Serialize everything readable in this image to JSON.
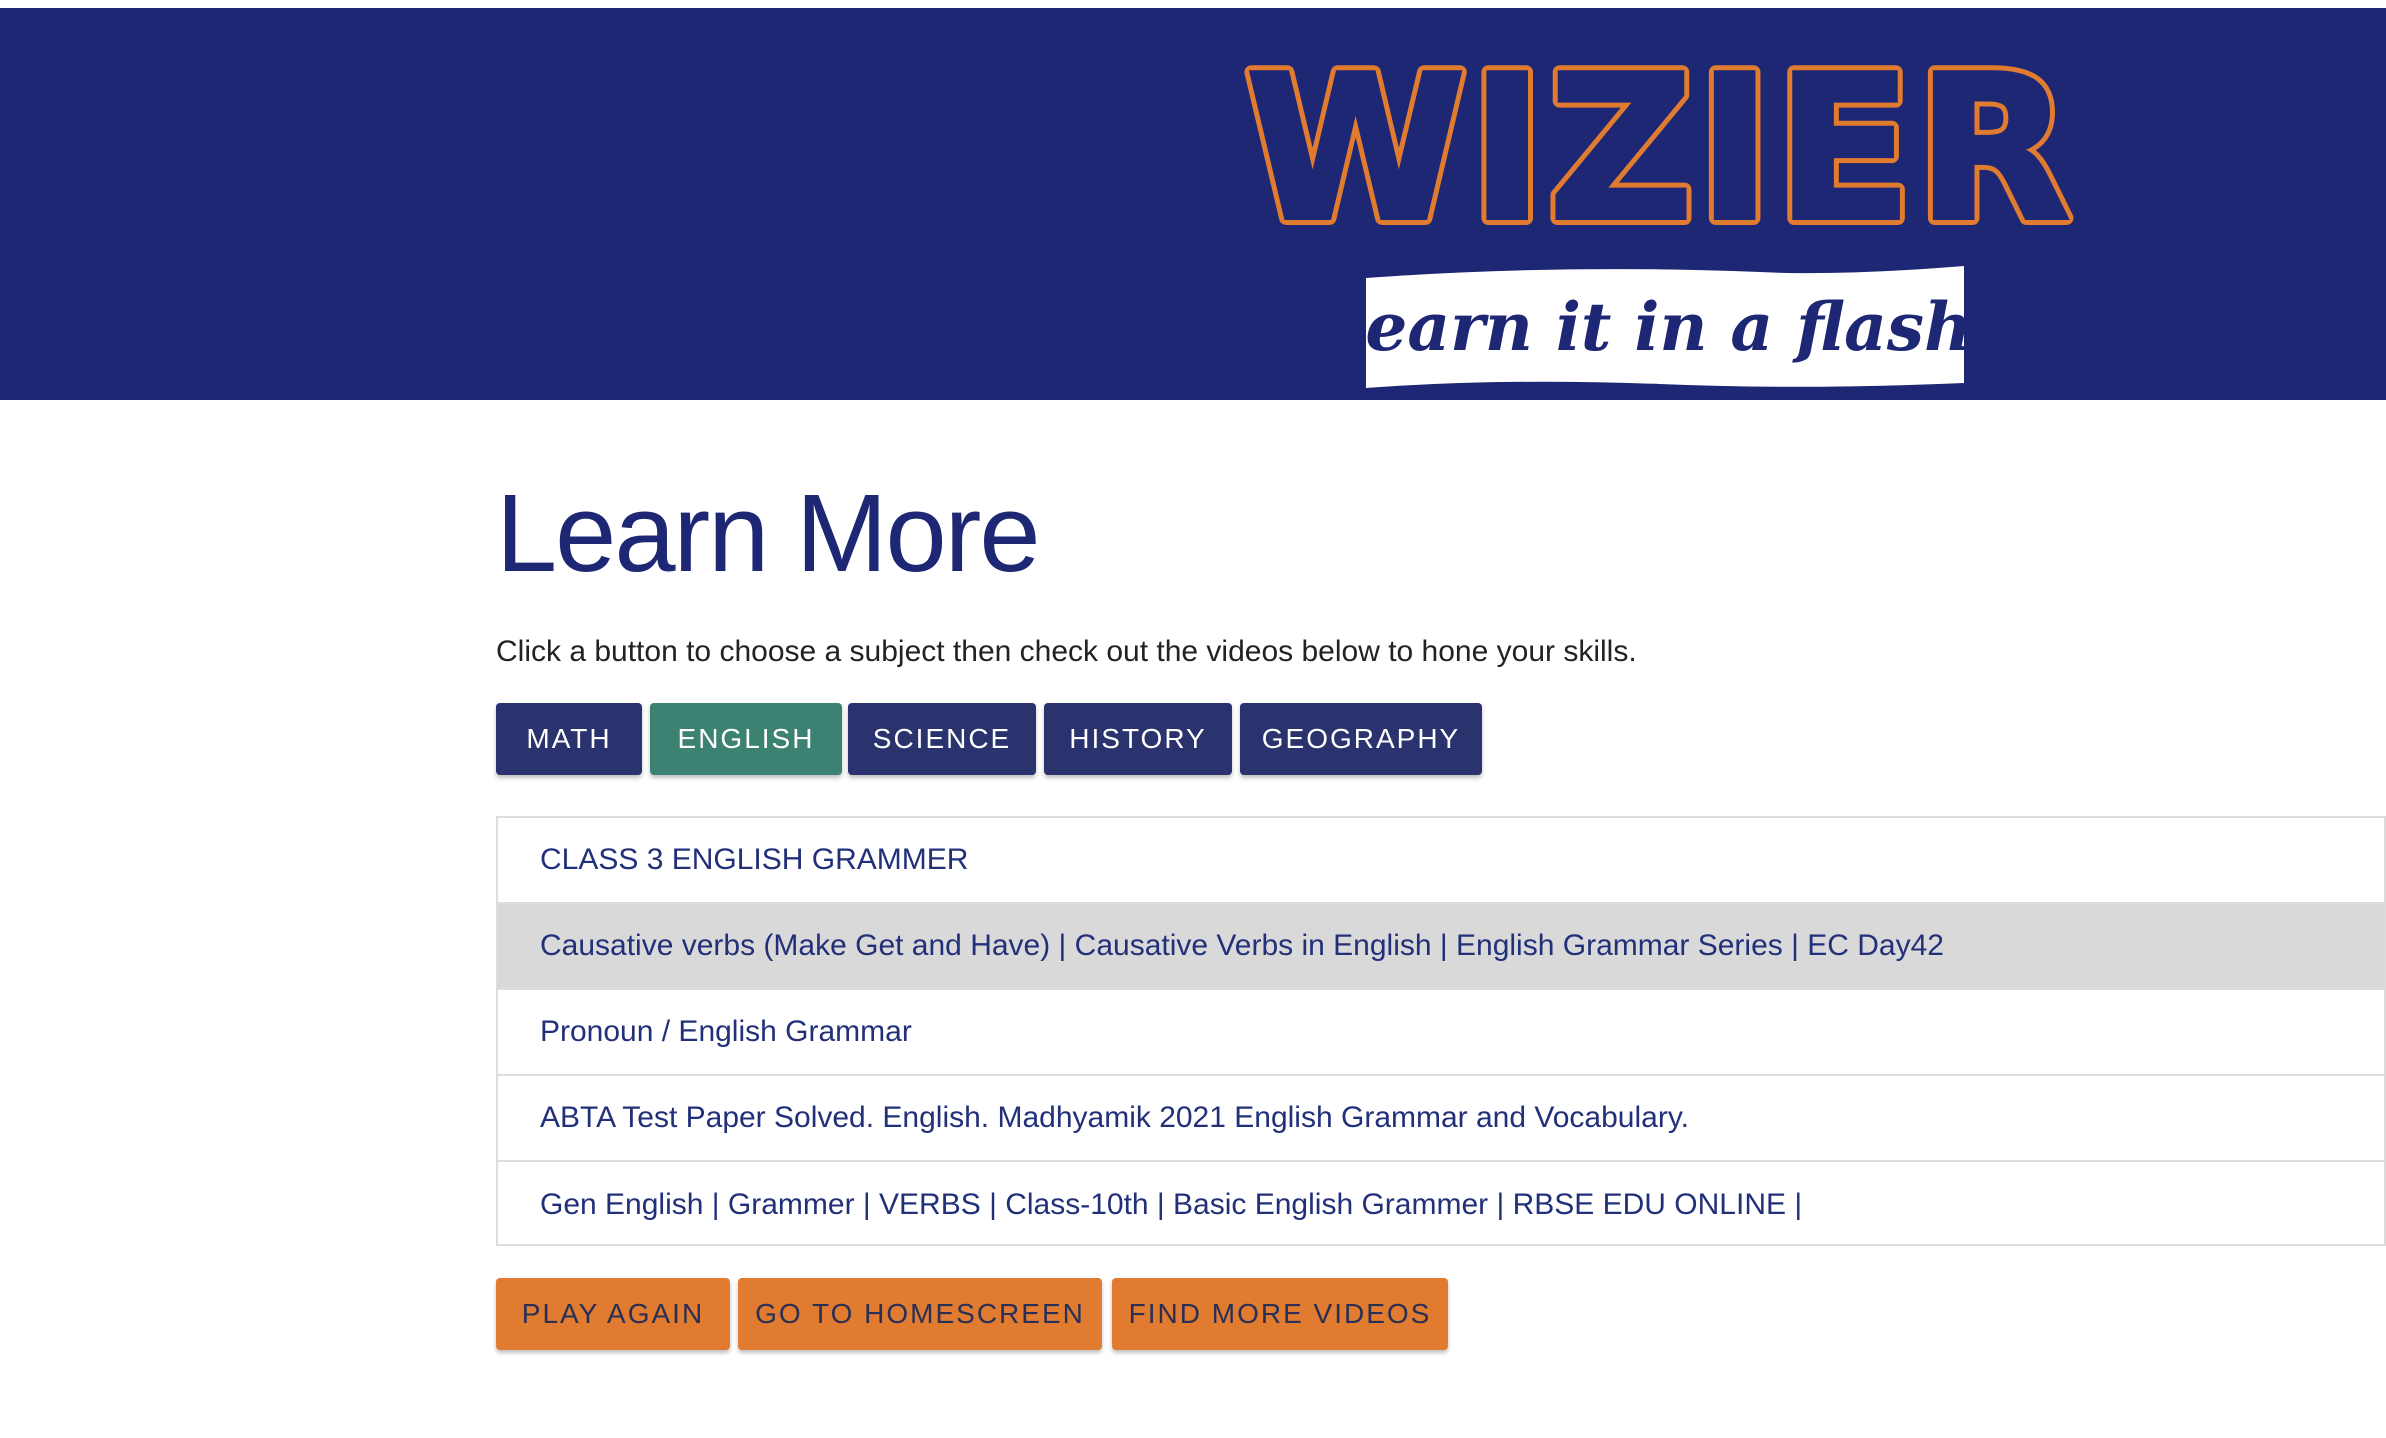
{
  "header": {
    "logo_text": "WIZIER",
    "tagline": "Learn it in a flash!",
    "background_color": "#1d2774",
    "brand_color": "#e07b30"
  },
  "main": {
    "title": "Learn More",
    "instructions": "Click a button to choose a subject then check out the videos below to hone your skills.",
    "subjects": [
      {
        "label": "MATH",
        "selected": false
      },
      {
        "label": "ENGLISH",
        "selected": true
      },
      {
        "label": "SCIENCE",
        "selected": false
      },
      {
        "label": "HISTORY",
        "selected": false
      },
      {
        "label": "GEOGRAPHY",
        "selected": false
      }
    ],
    "videos": [
      {
        "title": "CLASS 3 ENGLISH GRAMMER"
      },
      {
        "title": "Causative verbs (Make Get and Have) | Causative Verbs in English | English Grammar Series | EC Day42",
        "highlighted": true
      },
      {
        "title": "Pronoun / English Grammar"
      },
      {
        "title": "ABTA Test Paper Solved. English. Madhyamik 2021 English Grammar and Vocabulary."
      },
      {
        "title": "Gen English | Grammer | VERBS | Class-10th | Basic English Grammer | RBSE EDU ONLINE |"
      }
    ],
    "actions": {
      "play_again": "PLAY AGAIN",
      "go_home": "GO TO HOMESCREEN",
      "find_more": "FIND MORE VIDEOS"
    }
  },
  "colors": {
    "navy_button": "#2a336d",
    "selected_button": "#3b8272",
    "action_button": "#e07b30",
    "link_text": "#22307a"
  }
}
